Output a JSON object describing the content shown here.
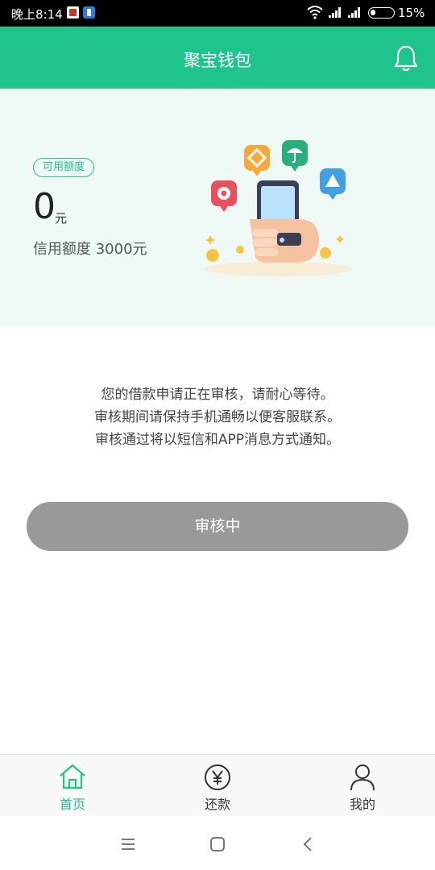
{
  "status_bar": {
    "time": "晚上8:14",
    "battery_percent": "15%"
  },
  "header": {
    "title": "聚宝钱包",
    "bell_icon": "bell-icon"
  },
  "credit": {
    "badge": "可用额度",
    "amount": "0",
    "unit": "元",
    "limit_text": "信用额度 3000元"
  },
  "notice": {
    "line1": "您的借款申请正在审核，请耐心等待。",
    "line2": "审核期间请保持手机通畅以便客服联系。",
    "line3": "审核通过将以短信和APP消息方式通知。"
  },
  "status_button": {
    "label": "审核中"
  },
  "tabs": [
    {
      "label": "首页",
      "icon": "home-icon",
      "active": true
    },
    {
      "label": "还款",
      "icon": "yen-icon",
      "active": false
    },
    {
      "label": "我的",
      "icon": "user-icon",
      "active": false
    }
  ],
  "colors": {
    "brand": "#1ec48b",
    "button_disabled": "#999999",
    "panel_bg": "#eef8f4"
  },
  "system_nav": [
    "menu-icon",
    "home-square-icon",
    "back-icon"
  ]
}
